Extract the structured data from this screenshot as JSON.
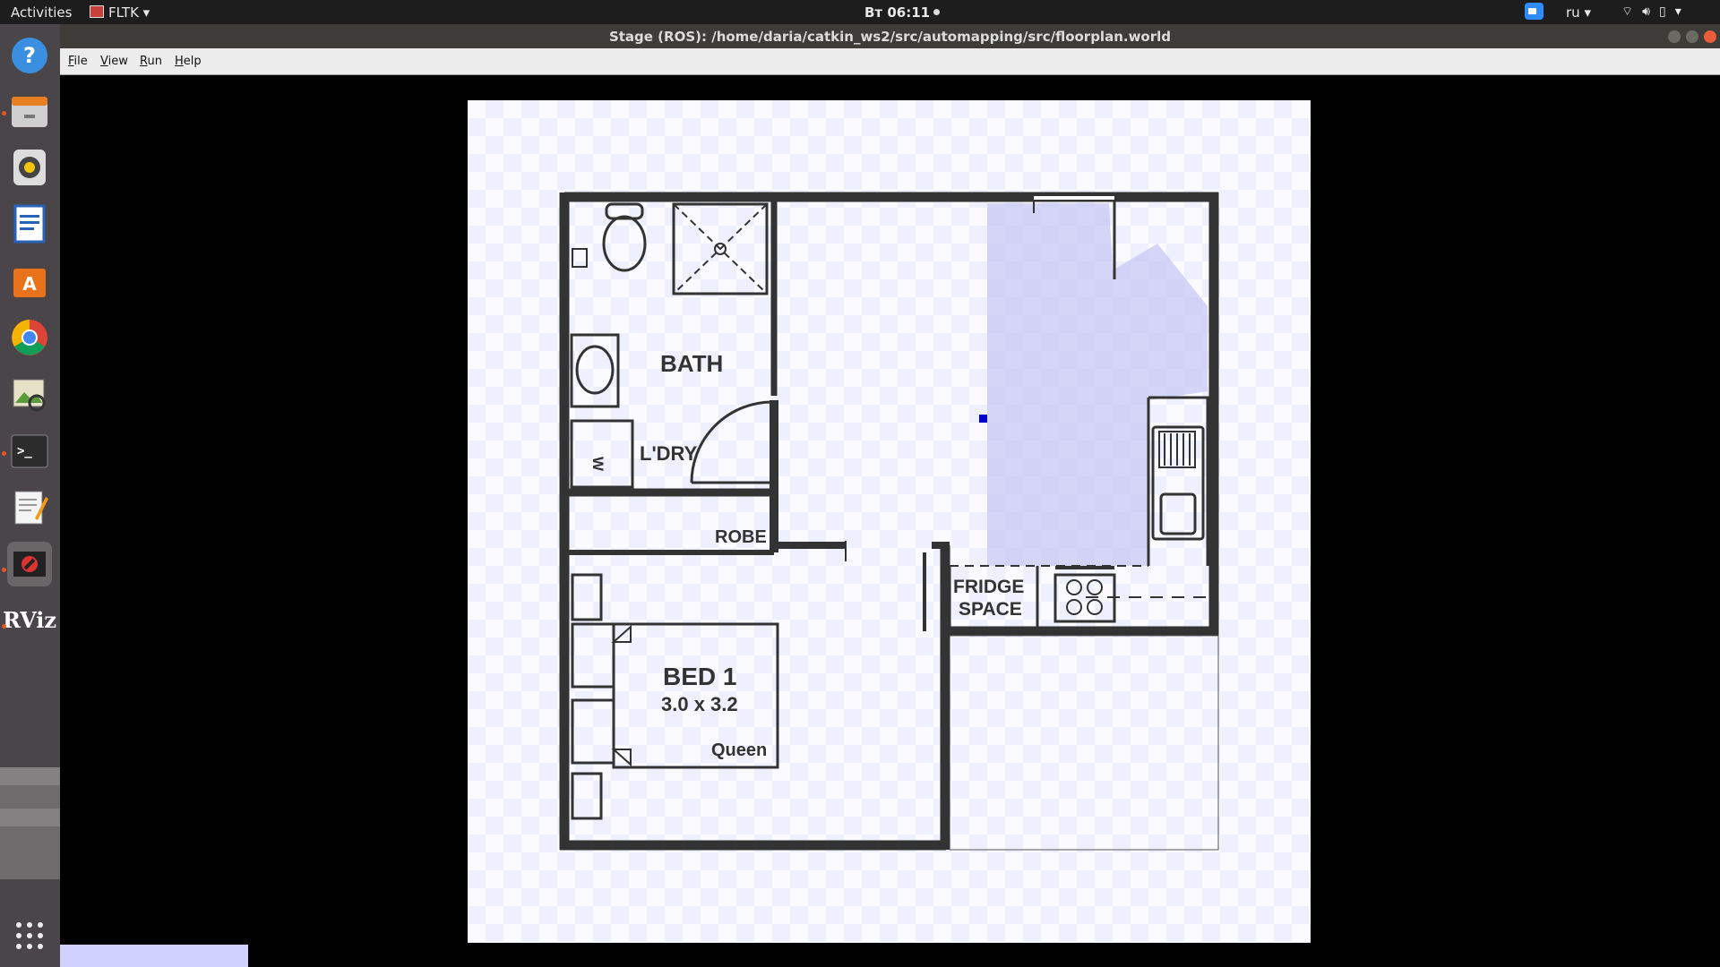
{
  "topbar": {
    "activities": "Activities",
    "app_menu": "FLTK ▾",
    "clock": "Вт 06:11",
    "language": "ru ▾",
    "tray_icons": [
      "wifi-icon",
      "volume-icon",
      "battery-icon",
      "power-menu-icon"
    ]
  },
  "dock": {
    "items": [
      "help-icon",
      "files-icon",
      "rhythmbox-icon",
      "writer-icon",
      "software-center-icon",
      "chrome-icon",
      "image-viewer-icon",
      "terminal-icon",
      "text-editor-icon",
      "stage-app-icon",
      "rviz-icon"
    ]
  },
  "window": {
    "title": "Stage (ROS): /home/daria/catkin_ws2/src/automapping/src/floorplan.world",
    "menu": {
      "file": {
        "underline": "F",
        "rest": "ile"
      },
      "view": {
        "underline": "V",
        "rest": "iew"
      },
      "run": {
        "underline": "R",
        "rest": "un"
      },
      "help": {
        "underline": "H",
        "rest": "elp"
      }
    }
  },
  "floorplan": {
    "labels": {
      "bath": "BATH",
      "laundry": "L'DRY",
      "washer": "W",
      "robe": "ROBE",
      "bed_title": "BED 1",
      "bed_size": "3.0 x 3.2",
      "bed_type": "Queen",
      "fridge_1": "FRIDGE",
      "fridge_2": "SPACE"
    },
    "colors": {
      "walls": "#333333",
      "sensor_fov": "#c8c8f4",
      "robot": "#0000cc",
      "grid": "#eff0fd"
    }
  }
}
